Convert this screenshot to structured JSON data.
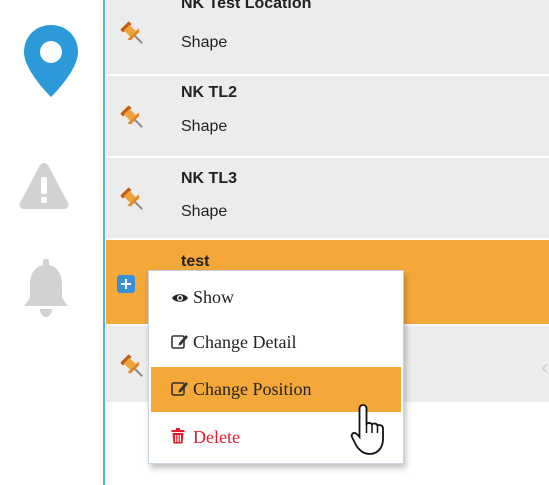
{
  "sidebar": {
    "icons": [
      "map-marker-icon",
      "warning-icon",
      "bell-icon"
    ]
  },
  "list": {
    "rows": [
      {
        "title": "NK Test Location",
        "subtitle": "Shape"
      },
      {
        "title": "NK TL2",
        "subtitle": "Shape"
      },
      {
        "title": "NK TL3",
        "subtitle": "Shape"
      },
      {
        "title": "test",
        "subtitle": "",
        "selected": true
      }
    ]
  },
  "context_menu": {
    "items": [
      {
        "label": "Show",
        "icon": "eye-icon"
      },
      {
        "label": "Change Detail",
        "icon": "edit-icon"
      },
      {
        "label": "Change Position",
        "icon": "edit-icon",
        "highlighted": true
      },
      {
        "label": "Delete",
        "icon": "trash-icon"
      }
    ]
  },
  "colors": {
    "accent_blue": "#2c9ad8",
    "selected_row": "#f5a83a",
    "row_bg": "#ececec",
    "delete_red": "#e8192c",
    "inactive_icon": "#d2d2d2"
  }
}
